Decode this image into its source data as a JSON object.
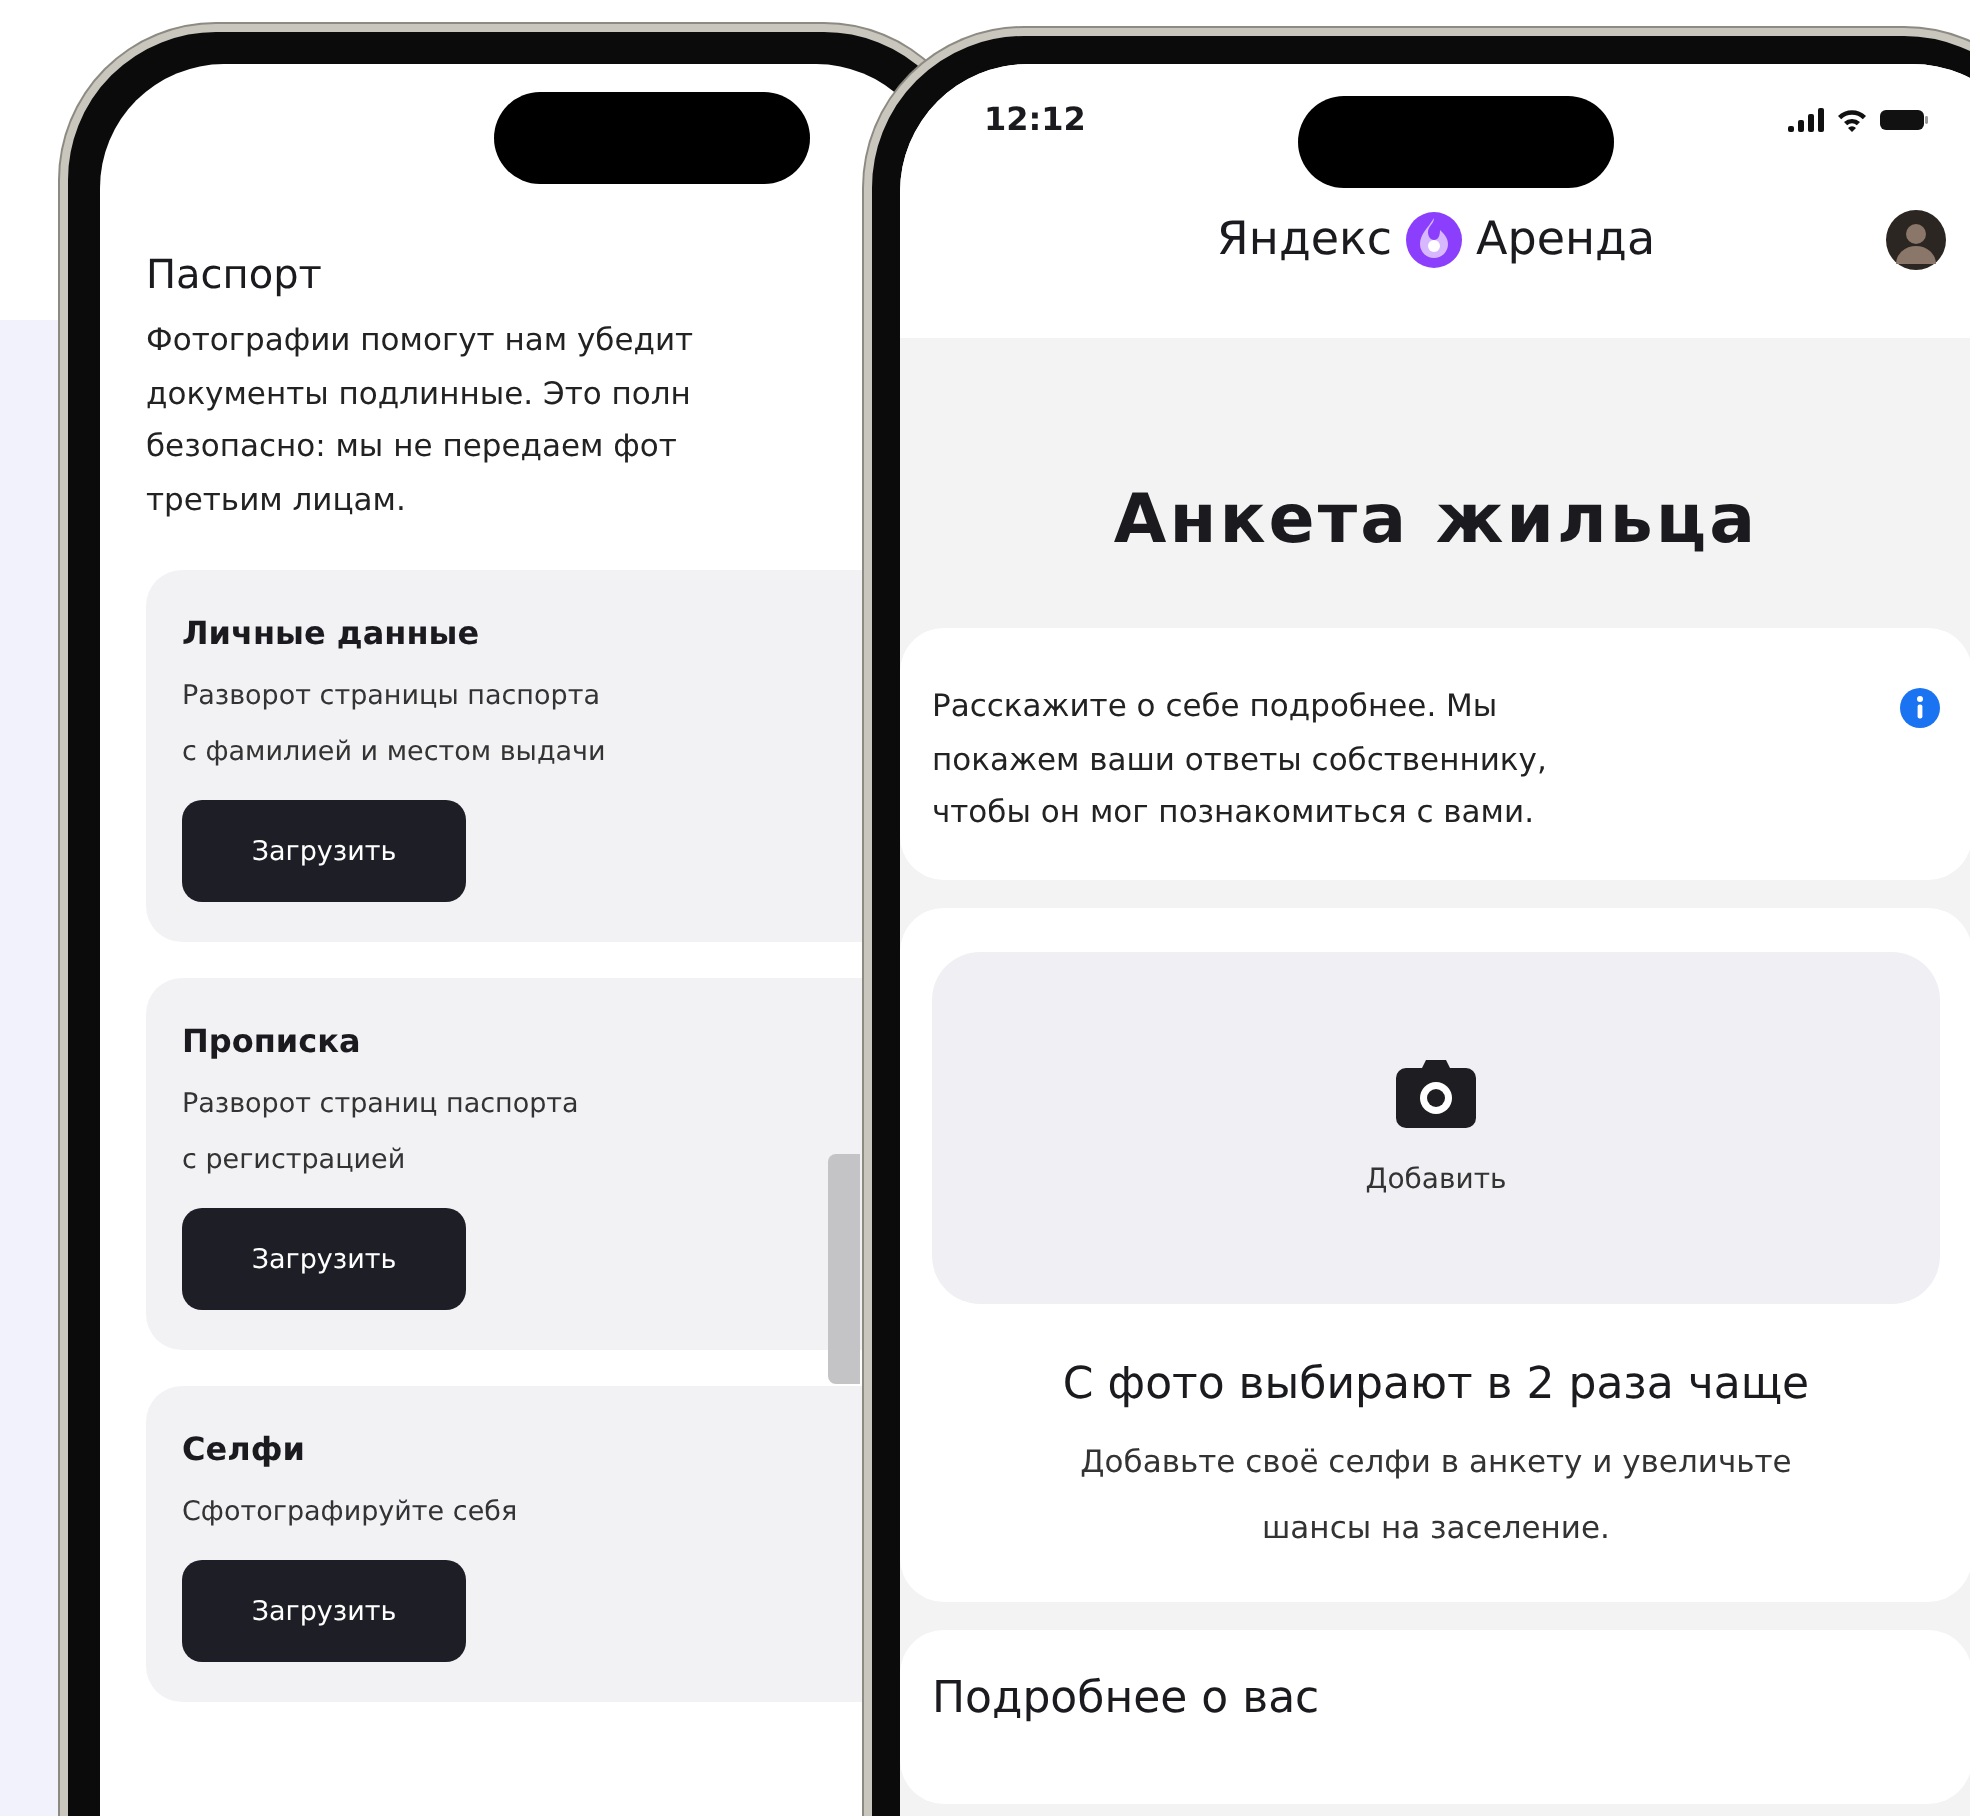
{
  "back_screen": {
    "title": "Паспорт",
    "intro": "Фотографии помогут нам убедит\nдокументы подлинные. Это полн\nбезопасно: мы не передаем фот\nтретьим лицам.",
    "documents": [
      {
        "title": "Личные данные",
        "description": "Разворот страницы паспорта\nс фамилией и местом выдачи",
        "button": "Загрузить"
      },
      {
        "title": "Прописка",
        "description": "Разворот страниц паспорта\nс регистрацией",
        "button": "Загрузить"
      },
      {
        "title": "Селфи",
        "description": "Сфотографируйте себя",
        "button": "Загрузить"
      }
    ]
  },
  "front_screen": {
    "status_bar": {
      "time": "12:12"
    },
    "header": {
      "brand": "Яндекс",
      "product": "Аренда"
    },
    "title": "Анкета жильца",
    "intro": "Расскажите о себе подробнее. Мы\nпокажем ваши ответы собственнику,\nчтобы он мог познакомиться с вами.",
    "photo_card": {
      "add_label": "Добавить",
      "heading": "С фото выбирают в 2 раза чаще",
      "text": "Добавьте своё селфи в анкету и увеличьте\nшансы на заселение."
    },
    "next_section": {
      "title": "Подробнее о вас"
    }
  }
}
